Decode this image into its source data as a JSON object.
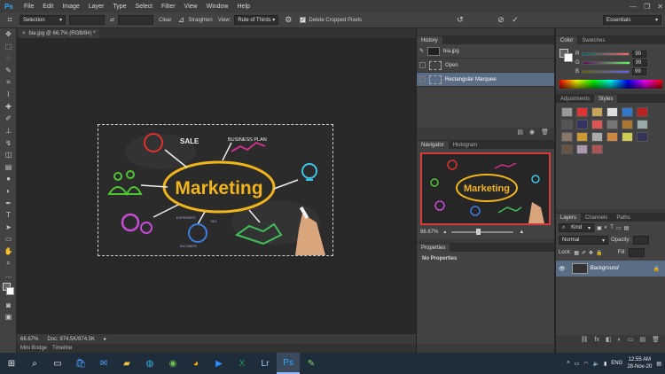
{
  "app": {
    "logo": "Ps"
  },
  "menu": [
    "File",
    "Edit",
    "Image",
    "Layer",
    "Type",
    "Select",
    "Filter",
    "View",
    "Window",
    "Help"
  ],
  "window_controls": {
    "minimize": "—",
    "maximize": "❐",
    "close": "✕"
  },
  "options": {
    "tool_icon": "crop-icon",
    "ratio_select": "Selection",
    "swap_label": "⇄",
    "clear_label": "Clear",
    "straighten_label": "Straighten",
    "view_label": "View:",
    "view_select": "Rule of Thirds",
    "delete_cropped_label": "Delete Cropped Pixels",
    "workspace": "Essentials"
  },
  "document": {
    "tab_title": "bia.jpg @ 66.7% (RGB/8#) *",
    "zoom": "66.67%",
    "doc_info": "Doc: 974.5K/974.5K"
  },
  "artwork": {
    "title": "Marketing",
    "sale": "SALE",
    "business_plan": "BUSINESS PLAN",
    "expenses": "EXPENSES",
    "incomes": "INCOMES",
    "tax": "TAX"
  },
  "bottom_tabs": [
    "Mini Bridge",
    "Timeline"
  ],
  "history": {
    "tabs": [
      "History"
    ],
    "snapshot": "bia.jpg",
    "items": [
      {
        "label": "Open",
        "selected": false
      },
      {
        "label": "Rectangular Marquee",
        "selected": true
      }
    ]
  },
  "navigator": {
    "tabs": [
      "Navigator",
      "Histogram"
    ],
    "zoom": "66.67%"
  },
  "properties": {
    "tabs": [
      "Properties"
    ],
    "empty": "No Properties"
  },
  "color": {
    "tabs": [
      "Color",
      "Swatches"
    ],
    "channels": [
      {
        "name": "R",
        "value": "99"
      },
      {
        "name": "G",
        "value": "99"
      },
      {
        "name": "B",
        "value": "99"
      }
    ]
  },
  "adjustments": {
    "tabs": [
      "Adjustments",
      "Styles"
    ]
  },
  "layers": {
    "tabs": [
      "Layers",
      "Channels",
      "Paths"
    ],
    "kind_label": "Kind",
    "blend_mode": "Normal",
    "opacity_label": "Opacity:",
    "lock_label": "Lock:",
    "fill_label": "Fill:",
    "layer_name": "Background"
  },
  "taskbar": {
    "icons": [
      "windows-icon",
      "search-icon",
      "task-view-icon",
      "store-icon",
      "mail-icon",
      "folder-icon",
      "edge-icon",
      "greenshot-icon",
      "chrome-icon",
      "zoom-icon",
      "excel-icon",
      "lightroom-icon",
      "photoshop-icon",
      "paint-icon"
    ],
    "time": "12:55 AM",
    "date": "28-Nov-20",
    "lang": "ENG"
  },
  "accent": "#31a8ff"
}
